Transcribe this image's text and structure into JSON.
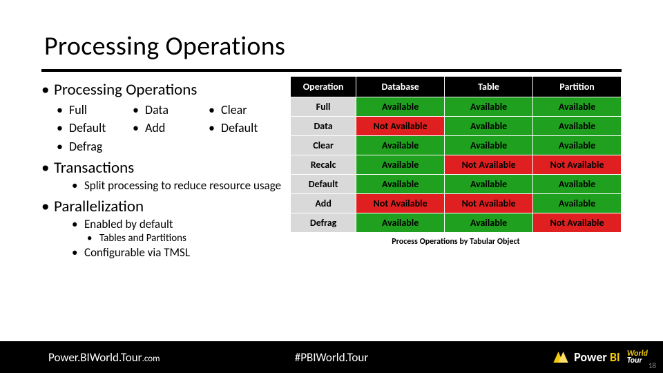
{
  "title": "Processing Operations",
  "bullets": {
    "h1": "Processing Operations",
    "ops": [
      "Full",
      "Data",
      "Clear",
      "Default",
      "Add",
      "Default",
      "Defrag"
    ],
    "h2": "Transactions",
    "h2_sub": "Split processing to reduce resource usage",
    "h3": "Parallelization",
    "h3_sub1": "Enabled by default",
    "h3_sub1a": "Tables and Partitions",
    "h3_sub2": "Configurable via TMSL"
  },
  "table": {
    "headers": [
      "Operation",
      "Database",
      "Table",
      "Partition"
    ],
    "rows": [
      {
        "op": "Full",
        "cells": [
          {
            "t": "Available",
            "c": "av"
          },
          {
            "t": "Available",
            "c": "av"
          },
          {
            "t": "Available",
            "c": "av"
          }
        ]
      },
      {
        "op": "Data",
        "cells": [
          {
            "t": "Not Available",
            "c": "na"
          },
          {
            "t": "Available",
            "c": "av"
          },
          {
            "t": "Available",
            "c": "av"
          }
        ]
      },
      {
        "op": "Clear",
        "cells": [
          {
            "t": "Available",
            "c": "av"
          },
          {
            "t": "Available",
            "c": "av"
          },
          {
            "t": "Available",
            "c": "av"
          }
        ]
      },
      {
        "op": "Recalc",
        "cells": [
          {
            "t": "Available",
            "c": "av"
          },
          {
            "t": "Not Available",
            "c": "na"
          },
          {
            "t": "Not Available",
            "c": "na"
          }
        ]
      },
      {
        "op": "Default",
        "cells": [
          {
            "t": "Available",
            "c": "av"
          },
          {
            "t": "Available",
            "c": "av"
          },
          {
            "t": "Available",
            "c": "av"
          }
        ]
      },
      {
        "op": "Add",
        "cells": [
          {
            "t": "Not Available",
            "c": "na"
          },
          {
            "t": "Not Available",
            "c": "na"
          },
          {
            "t": "Available",
            "c": "av"
          }
        ]
      },
      {
        "op": "Defrag",
        "cells": [
          {
            "t": "Available",
            "c": "av"
          },
          {
            "t": "Available",
            "c": "av"
          },
          {
            "t": "Not Available",
            "c": "na"
          }
        ]
      }
    ],
    "caption": "Process Operations by Tabular Object"
  },
  "footer": {
    "url_main": "Power.BIWorld.Tour",
    "url_suffix": ".com",
    "hashtag": "#PBIWorld.Tour",
    "brand1": "Power ",
    "brand2": "BI",
    "brand3a": "World",
    "brand3b": "Tour",
    "page": "18"
  },
  "chart_data": {
    "type": "table",
    "title": "Process Operations by Tabular Object",
    "columns": [
      "Operation",
      "Database",
      "Table",
      "Partition"
    ],
    "rows": [
      [
        "Full",
        "Available",
        "Available",
        "Available"
      ],
      [
        "Data",
        "Not Available",
        "Available",
        "Available"
      ],
      [
        "Clear",
        "Available",
        "Available",
        "Available"
      ],
      [
        "Recalc",
        "Available",
        "Not Available",
        "Not Available"
      ],
      [
        "Default",
        "Available",
        "Available",
        "Available"
      ],
      [
        "Add",
        "Not Available",
        "Not Available",
        "Available"
      ],
      [
        "Defrag",
        "Available",
        "Available",
        "Not Available"
      ]
    ]
  }
}
